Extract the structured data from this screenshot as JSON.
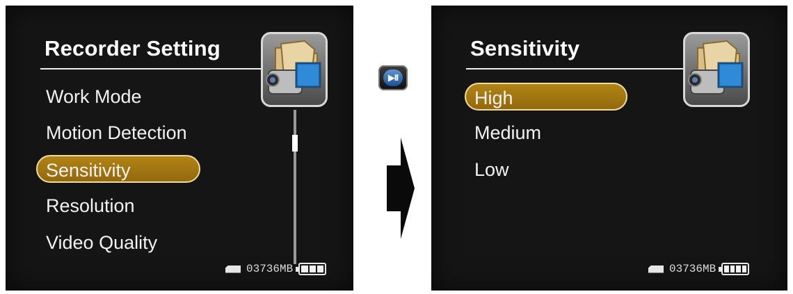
{
  "left_screen": {
    "title": "Recorder Setting",
    "menu_items": [
      "Work Mode",
      "Motion Detection",
      "Sensitivity",
      "Resolution",
      "Video Quality"
    ],
    "selected_index": 2,
    "storage": "03736MB",
    "camera_icon": "camcorder-folder-icon",
    "scroll_position": 0.18
  },
  "right_screen": {
    "title": "Sensitivity",
    "options": [
      "High",
      "Medium",
      "Low"
    ],
    "selected_index": 0,
    "storage": "03736MB",
    "camera_icon": "camcorder-folder-icon"
  },
  "button": {
    "icon": "play-pause-icon",
    "label": "▶II"
  },
  "arrow": {
    "icon": "right-arrow-icon"
  },
  "colors": {
    "highlight": "#a27812",
    "highlight_border": "#f1dca0",
    "screen_bg": "#151515",
    "text": "#f2f2f2"
  }
}
